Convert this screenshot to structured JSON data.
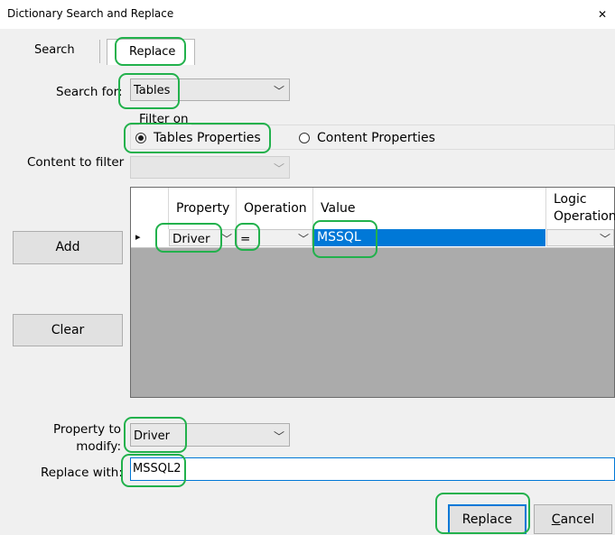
{
  "window": {
    "title": "Dictionary Search and Replace",
    "close_glyph": "✕"
  },
  "tabs": [
    {
      "label": "Search",
      "active": false
    },
    {
      "label": "Replace",
      "active": true
    }
  ],
  "form": {
    "search_for_label": "Search for:",
    "search_for_value": "Tables",
    "filter_on_label": "Filter on",
    "radio_tables": "Tables Properties",
    "radio_content": "Content Properties",
    "content_to_filter_label": "Content to filter",
    "property_to_modify_label_1": "Property to",
    "property_to_modify_label_2": "modify:",
    "property_to_modify_value": "Driver",
    "replace_with_label": "Replace with:",
    "replace_with_value": "MSSQL2"
  },
  "grid": {
    "columns": [
      "Property",
      "Operation",
      "Value",
      "Logic",
      "Operation"
    ],
    "row_indicator": "▸",
    "rows": [
      {
        "property": "Driver",
        "operation": "=",
        "value": "MSSQL",
        "logic": ""
      }
    ]
  },
  "buttons": {
    "add": "Add",
    "clear": "Clear",
    "replace": "Replace",
    "cancel_prefix": "C",
    "cancel_rest": "ancel"
  },
  "icons": {
    "dropdown": "chevron-down-icon"
  },
  "colors": {
    "highlight": "#22b14c",
    "selection": "#0078d7",
    "grid_background": "#ababab"
  }
}
